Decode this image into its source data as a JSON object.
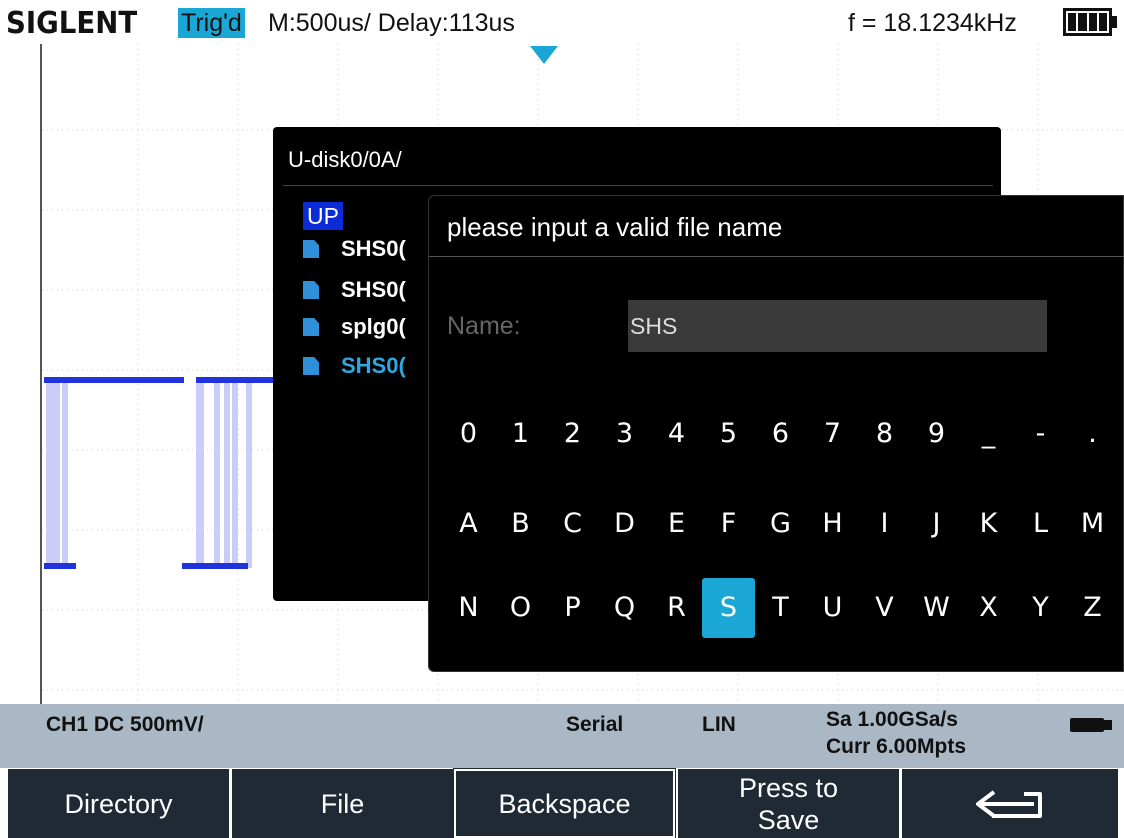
{
  "status_bar": {
    "brand": "SIGLENT",
    "trigger_status": "Trig'd",
    "timebase": "M:500us/ Delay:113us",
    "frequency": "f = 18.1234kHz"
  },
  "file_browser": {
    "path": "U-disk0/0A/",
    "up_label": "UP",
    "items": [
      {
        "name": "SHS0("
      },
      {
        "name": "SHS0("
      },
      {
        "name": "splg0("
      },
      {
        "name": "SHS0("
      }
    ]
  },
  "input_dialog": {
    "title": "please input a valid file name",
    "name_label": "Name:",
    "name_value": "SHS",
    "keyboard_rows": [
      [
        "0",
        "1",
        "2",
        "3",
        "4",
        "5",
        "6",
        "7",
        "8",
        "9",
        "_",
        "-",
        "."
      ],
      [
        "A",
        "B",
        "C",
        "D",
        "E",
        "F",
        "G",
        "H",
        "I",
        "J",
        "K",
        "L",
        "M"
      ],
      [
        "N",
        "O",
        "P",
        "Q",
        "R",
        "S",
        "T",
        "U",
        "V",
        "W",
        "X",
        "Y",
        "Z"
      ]
    ],
    "selected_key": "S"
  },
  "info_bar": {
    "channel": "CH1 DC 500mV/",
    "mode": "Serial",
    "scale": "LIN",
    "sample_rate": "Sa 1.00GSa/s",
    "memory": "Curr 6.00Mpts"
  },
  "softkeys": {
    "directory": "Directory",
    "file": "File",
    "backspace": "Backspace",
    "press_to_save_line1": "Press to",
    "press_to_save_line2": "Save"
  },
  "colors": {
    "accent": "#1aa7d6",
    "up_highlight": "#0a2bd6",
    "waveform": "#2233dd",
    "info_bar_bg": "#aab7c4",
    "softkey_bg": "#202a34"
  }
}
